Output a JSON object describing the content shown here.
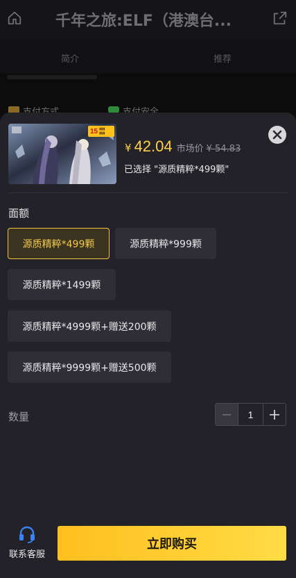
{
  "background": {
    "title": "千年之旅:ELF（港澳台...",
    "tabs": [
      "简介",
      "推荐"
    ],
    "pay_items": [
      "支付方式",
      "支付安全"
    ]
  },
  "product": {
    "badge_number": "15",
    "currency": "¥",
    "price": "42.04",
    "market_label": "市场价",
    "market_price": "¥ 54.83",
    "selected_text": "已选择 \"源质精粹*499颗\""
  },
  "amount": {
    "label": "面额",
    "options": [
      {
        "label": "源质精粹*499颗",
        "selected": true
      },
      {
        "label": "源质精粹*999颗",
        "selected": false
      },
      {
        "label": "源质精粹*1499颗",
        "selected": false
      },
      {
        "label": "源质精粹*4999颗+赠送200颗",
        "selected": false
      },
      {
        "label": "源质精粹*9999颗+赠送500颗",
        "selected": false
      }
    ]
  },
  "quantity": {
    "label": "数量",
    "value": "1"
  },
  "footer": {
    "service_label": "联系客服",
    "buy_label": "立即购买"
  },
  "colors": {
    "accent": "#f4c94a",
    "sheet_bg": "#232228",
    "option_bg": "#2f2e36",
    "service_icon": "#3b82f6"
  },
  "icons": [
    "home-icon",
    "share-icon",
    "close-icon",
    "minus-icon",
    "plus-icon",
    "headset-icon"
  ]
}
